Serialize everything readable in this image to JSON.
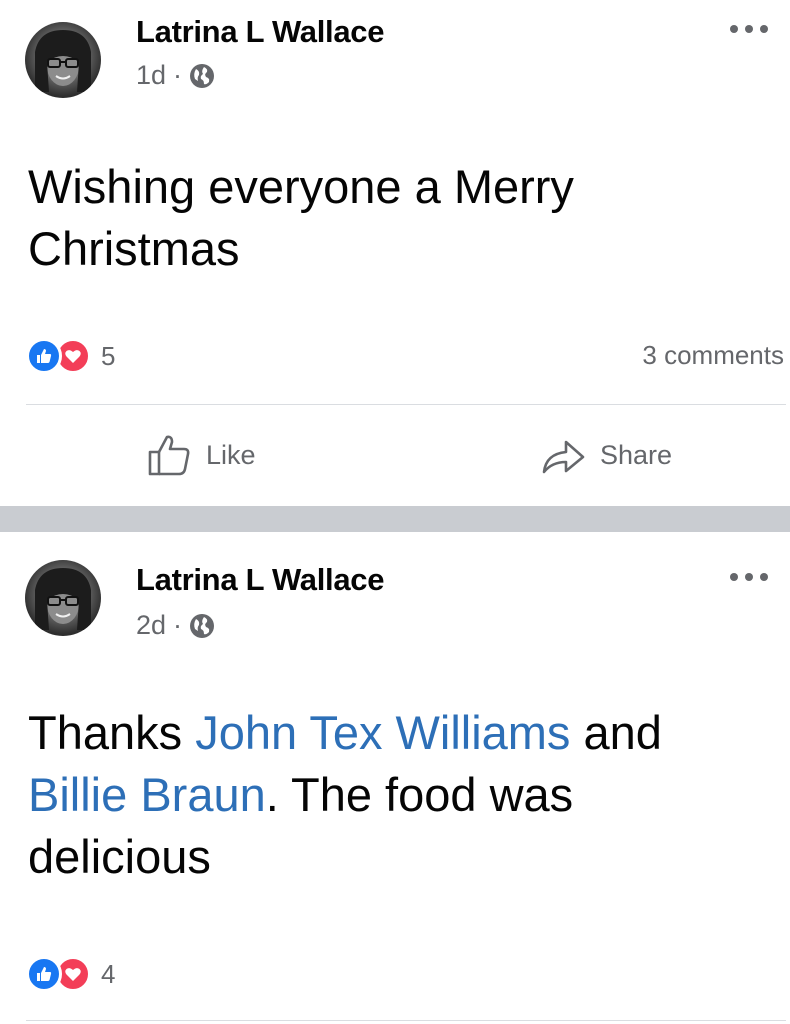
{
  "posts": [
    {
      "author": "Latrina L Wallace",
      "time": "1d",
      "separator": "·",
      "text": "Wishing everyone a Merry Christmas",
      "reaction_count": "5",
      "comments": "3 comments",
      "actions": {
        "like": "Like",
        "share": "Share"
      }
    },
    {
      "author": "Latrina L Wallace",
      "time": "2d",
      "separator": "·",
      "text_segments": [
        {
          "text": "Thanks ",
          "mention": false
        },
        {
          "text": "John Tex Williams",
          "mention": true
        },
        {
          "text": " and ",
          "mention": false
        },
        {
          "text": "Billie Braun",
          "mention": true
        },
        {
          "text": ". The food was delicious",
          "mention": false
        }
      ],
      "reaction_count": "4"
    }
  ],
  "colors": {
    "mention": "#2d6fb7",
    "like_reaction": "#1877f2",
    "love_reaction": "#f33e58",
    "divider": "#c9ccd1",
    "secondary_text": "#65676b"
  },
  "icons": {
    "privacy": "globe-icon",
    "menu": "more-options-icon",
    "like": "thumbs-up-icon",
    "share": "share-arrow-icon",
    "reaction_like": "like-reaction-icon",
    "reaction_love": "love-reaction-icon"
  }
}
